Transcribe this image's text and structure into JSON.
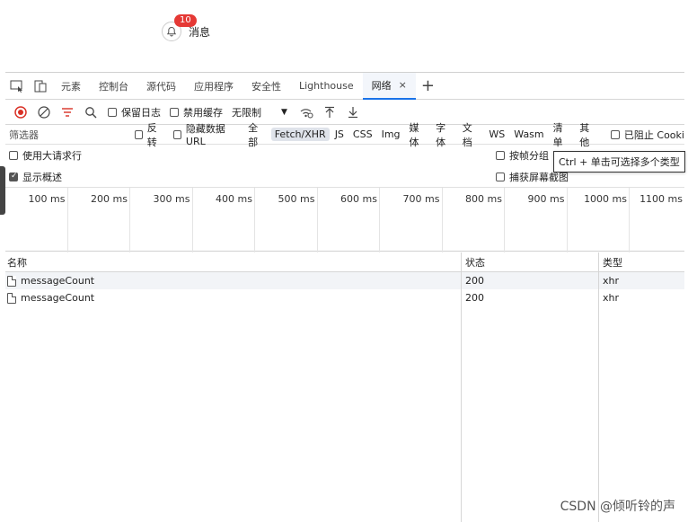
{
  "page": {
    "badge_count": "10",
    "message_label": "消息"
  },
  "devtools": {
    "tabs": [
      {
        "label": "元素"
      },
      {
        "label": "控制台"
      },
      {
        "label": "源代码"
      },
      {
        "label": "应用程序"
      },
      {
        "label": "安全性"
      },
      {
        "label": "Lighthouse"
      },
      {
        "label": "网络",
        "close": "×"
      }
    ],
    "toolbar": {
      "preserve_log": "保留日志",
      "disable_cache": "禁用缓存",
      "throttle": "无限制"
    },
    "filter": {
      "placeholder": "筛选器",
      "invert": "反转",
      "hide_data_url": "隐藏数据 URL",
      "types": [
        "全部",
        "Fetch/XHR",
        "JS",
        "CSS",
        "Img",
        "媒体",
        "字体",
        "文档",
        "WS",
        "Wasm",
        "清单",
        "其他"
      ],
      "blocked": "已阻止 Cooki"
    },
    "options": {
      "large_rows": "使用大请求行",
      "group_by_frame": "按帧分组",
      "show_overview": "显示概述",
      "capture_screenshots": "捕获屏幕截图",
      "tooltip": "Ctrl + 单击可选择多个类型"
    },
    "timeline_ticks": [
      "100 ms",
      "200 ms",
      "300 ms",
      "400 ms",
      "500 ms",
      "600 ms",
      "700 ms",
      "800 ms",
      "900 ms",
      "1000 ms",
      "1100 ms"
    ],
    "table": {
      "headers": {
        "name": "名称",
        "status": "状态",
        "type": "类型"
      },
      "rows": [
        {
          "name": "messageCount",
          "status": "200",
          "type": "xhr"
        },
        {
          "name": "messageCount",
          "status": "200",
          "type": "xhr"
        }
      ]
    }
  },
  "watermark": "CSDN @倾听铃的声"
}
